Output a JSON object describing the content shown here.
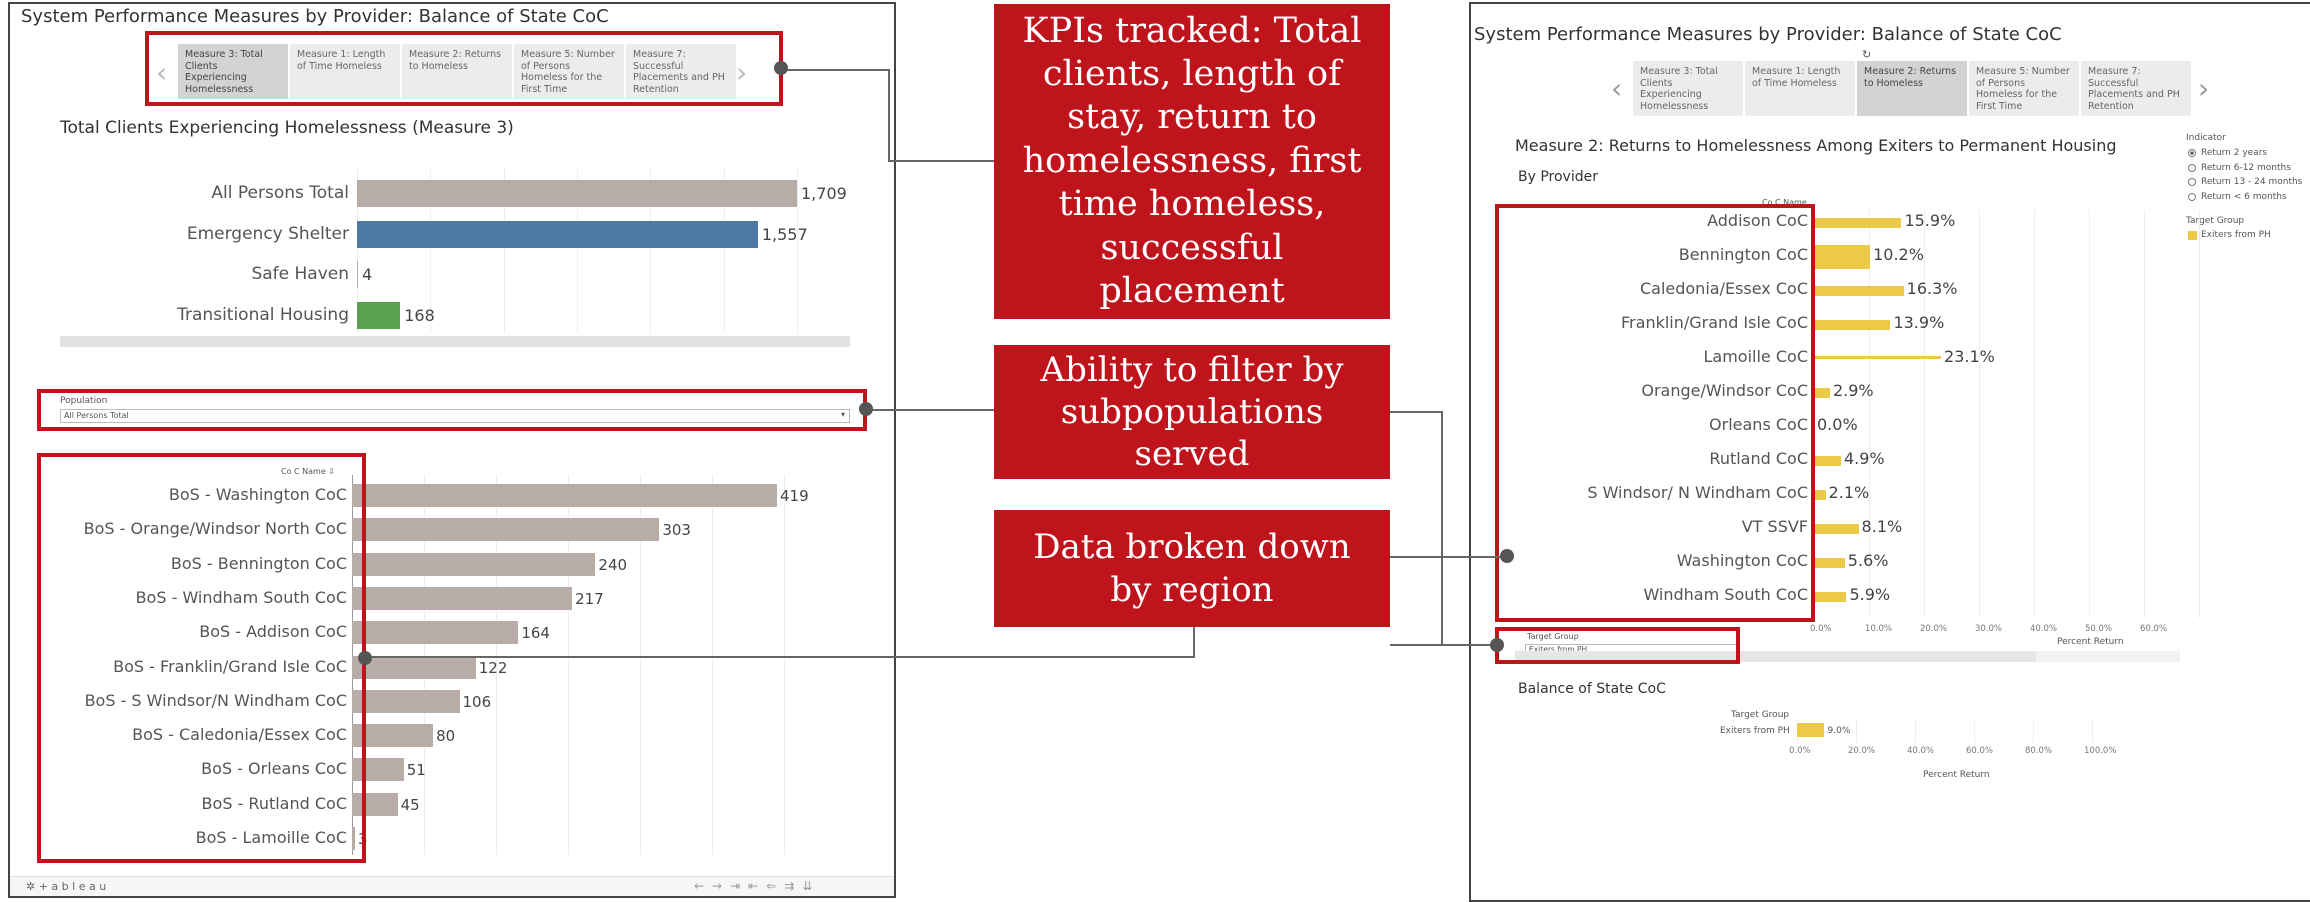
{
  "left": {
    "title": "System Performance Measures by Provider: Balance of State CoC",
    "tabs": [
      {
        "label": "Measure 3: Total Clients Experiencing Homelessness",
        "active": true
      },
      {
        "label": "Measure 1: Length of Time Homeless",
        "active": false
      },
      {
        "label": "Measure 2: Returns to Homeless",
        "active": false
      },
      {
        "label": "Measure 5: Number of Persons Homeless for the First Time",
        "active": false
      },
      {
        "label": "Measure 7: Successful Placements and PH Retention",
        "active": false
      }
    ],
    "chart_title": "Total Clients Experiencing Homelessness (Measure 3)",
    "population_label": "Population",
    "population_value": "All Persons Total",
    "coc_header": "Co C Name",
    "footer_brand": "+ a b l e a u"
  },
  "right": {
    "title": "System Performance Measures by Provider: Balance of State CoC",
    "tabs": [
      {
        "label": "Measure 3: Total Clients Experiencing Homelessness",
        "active": false
      },
      {
        "label": "Measure 1: Length of Time Homeless",
        "active": false
      },
      {
        "label": "Measure 2: Returns to Homeless",
        "active": true
      },
      {
        "label": "Measure 5: Number of Persons Homeless for the First Time",
        "active": false
      },
      {
        "label": "Measure 7: Successful Placements and PH Retention",
        "active": false
      }
    ],
    "chart_title": "Measure 2: Returns to Homelessness Among Exiters to Permanent Housing",
    "subtitle": "By Provider",
    "coc_header": "Co C Name",
    "indicator_title": "Indicator",
    "indicator_options": [
      "Return 2 years",
      "Return 6-12 months",
      "Return 13 - 24 months",
      "Return < 6 months"
    ],
    "target_legend_title": "Target Group",
    "target_legend_item": "Exiters from PH",
    "target_filter_label": "Target Group",
    "target_filter_value": "Exiters from PH",
    "axis_label": "Percent Return",
    "bos_title": "Balance of State CoC",
    "bos_group_header": "Target Group",
    "bos_group_label": "Exiters from PH",
    "bos_value_label": "9.0%",
    "bos_axis_label": "Percent Return"
  },
  "callouts": {
    "kpi": "KPIs tracked: Total clients, length of stay, return to homelessness, first time homeless, successful placement",
    "filter": "Ability to filter by subpopulations served",
    "region": "Data broken down by region"
  },
  "colors": {
    "red": "#c0141d",
    "bar_gray": "#b8aca8",
    "bar_blue": "#4e79a7",
    "bar_green": "#59a14f",
    "bar_yellow": "#edc948"
  },
  "chart_data": [
    {
      "type": "bar",
      "orientation": "horizontal",
      "title": "Total Clients Experiencing Homelessness (Measure 3)",
      "categories": [
        "All Persons Total",
        "Emergency Shelter",
        "Safe Haven",
        "Transitional Housing"
      ],
      "values": [
        1709,
        1557,
        4,
        168
      ],
      "value_labels": [
        "1,709",
        "1,557",
        "4",
        "168"
      ],
      "colors": [
        "#b8aca8",
        "#4e79a7",
        "#b8aca8",
        "#59a14f"
      ],
      "xlim": [
        0,
        1709
      ]
    },
    {
      "type": "bar",
      "orientation": "horizontal",
      "title": "",
      "categories": [
        "BoS - Washington CoC",
        "BoS - Orange/Windsor North CoC",
        "BoS - Bennington CoC",
        "BoS - Windham South CoC",
        "BoS - Addison CoC",
        "BoS - Franklin/Grand Isle CoC",
        "BoS - S Windsor/N Windham CoC",
        "BoS - Caledonia/Essex CoC",
        "BoS - Orleans CoC",
        "BoS - Rutland CoC",
        "BoS - Lamoille CoC"
      ],
      "values": [
        419,
        303,
        240,
        217,
        164,
        122,
        106,
        80,
        51,
        45,
        3
      ],
      "xlim": [
        0,
        419
      ]
    },
    {
      "type": "bar",
      "orientation": "horizontal",
      "title": "Measure 2: Returns to Homelessness Among Exiters to Permanent Housing",
      "xlabel": "Percent Return",
      "categories": [
        "Addison CoC",
        "Bennington CoC",
        "Caledonia/Essex CoC",
        "Franklin/Grand Isle CoC",
        "Lamoille CoC",
        "Orange/Windsor CoC",
        "Orleans CoC",
        "Rutland CoC",
        "S Windsor/ N Windham CoC",
        "VT SSVF",
        "Washington CoC",
        "Windham South CoC"
      ],
      "values": [
        15.9,
        10.2,
        16.3,
        13.9,
        23.1,
        2.9,
        0.0,
        4.9,
        2.1,
        8.1,
        5.6,
        5.9
      ],
      "value_labels": [
        "15.9%",
        "10.2%",
        "16.3%",
        "13.9%",
        "23.1%",
        "2.9%",
        "0.0%",
        "4.9%",
        "2.1%",
        "8.1%",
        "5.6%",
        "5.9%"
      ],
      "series": [
        {
          "name": "Exiters from PH"
        }
      ],
      "xticks": [
        "0.0%",
        "10.0%",
        "20.0%",
        "30.0%",
        "40.0%",
        "50.0%",
        "60.0%"
      ],
      "xlim": [
        0,
        60
      ]
    },
    {
      "type": "bar",
      "orientation": "horizontal",
      "title": "Balance of State CoC",
      "xlabel": "Percent Return",
      "categories": [
        "Exiters from PH"
      ],
      "values": [
        9.0
      ],
      "xticks": [
        "0.0%",
        "20.0%",
        "40.0%",
        "60.0%",
        "80.0%",
        "100.0%"
      ],
      "xlim": [
        0,
        100
      ]
    }
  ]
}
